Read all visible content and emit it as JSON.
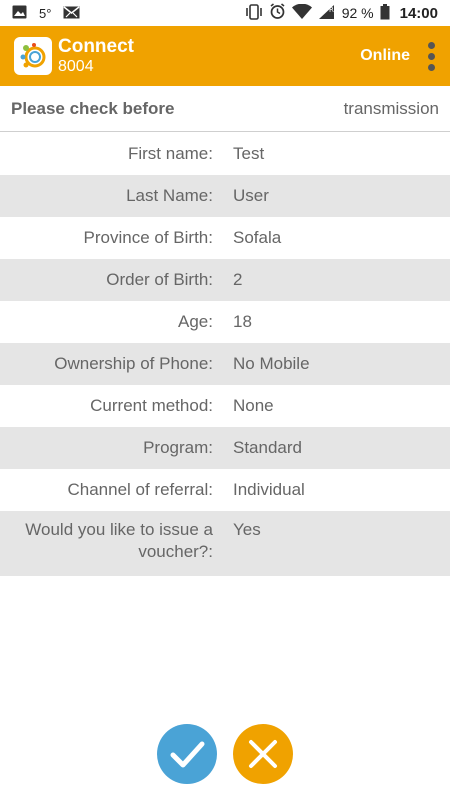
{
  "status_bar": {
    "temperature": "5°",
    "battery_percent": "92 %",
    "time": "14:00",
    "icons": [
      "image-icon",
      "mail-icon",
      "vibrate-icon",
      "alarm-icon",
      "wifi-icon",
      "signal-icon",
      "battery-icon"
    ]
  },
  "app_bar": {
    "title": "Connect",
    "subtitle": "8004",
    "status": "Online",
    "color": "#F0A200"
  },
  "check_header": {
    "left": "Please check before",
    "right": "transmission"
  },
  "rows": [
    {
      "label": "First name:",
      "value": "Test"
    },
    {
      "label": "Last Name:",
      "value": "User"
    },
    {
      "label": "Province of Birth:",
      "value": "Sofala"
    },
    {
      "label": "Order of Birth:",
      "value": "2"
    },
    {
      "label": "Age:",
      "value": "18"
    },
    {
      "label": "Ownership of Phone:",
      "value": "No Mobile"
    },
    {
      "label": "Current method:",
      "value": "None"
    },
    {
      "label": "Program:",
      "value": "Standard"
    },
    {
      "label": "Channel of referral:",
      "value": "Individual"
    },
    {
      "label": "Would you like to issue a voucher?:",
      "value": "Yes"
    }
  ],
  "actions": {
    "confirm_icon": "check-icon",
    "cancel_icon": "close-icon",
    "confirm_color": "#4AA3D6",
    "cancel_color": "#F0A200"
  }
}
